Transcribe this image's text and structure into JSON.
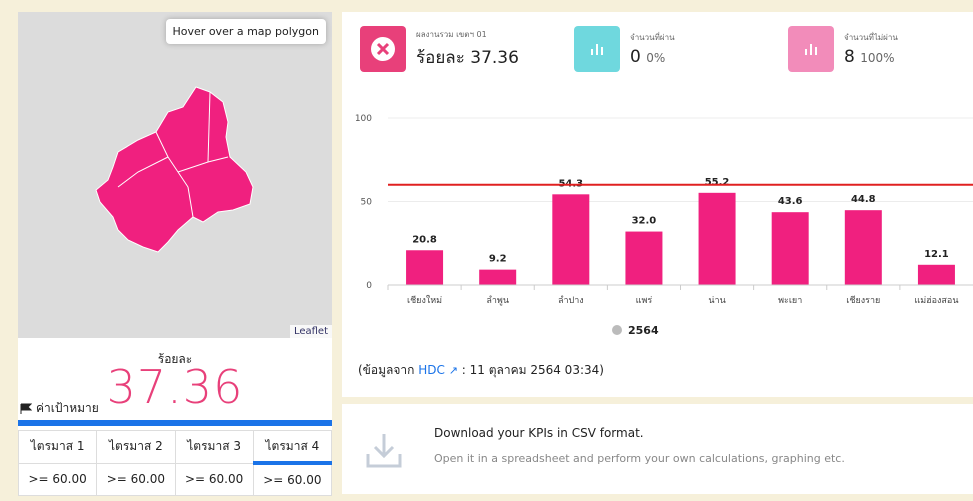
{
  "map": {
    "hover_hint": "Hover over a map polygon",
    "attribution": "Leaflet"
  },
  "summary": {
    "percent_label": "ร้อยละ",
    "percent_value": "37.36",
    "target_label": "ค่าเป้าหมาย"
  },
  "quarters": {
    "headers": [
      "ไตรมาส 1",
      "ไตรมาส 2",
      "ไตรมาส 3",
      "ไตรมาส 4"
    ],
    "values": [
      ">= 60.00",
      ">= 60.00",
      ">= 60.00",
      ">= 60.00"
    ]
  },
  "stats": [
    {
      "label": "ผลงานรวม เขตฯ 01",
      "value": "ร้อยละ 37.36",
      "sub": "",
      "color": "#e8407a",
      "icon": "close-icon"
    },
    {
      "label": "จำนวนที่ผ่าน",
      "value": "0",
      "sub": "0%",
      "color": "#6fd8de",
      "icon": "bar-chart-icon"
    },
    {
      "label": "จำนวนที่ไม่ผ่าน",
      "value": "8",
      "sub": "100%",
      "color": "#f28cba",
      "icon": "bar-chart-icon"
    }
  ],
  "chart_data": {
    "type": "bar",
    "categories": [
      "เชียงใหม่",
      "ลำพูน",
      "ลำปาง",
      "แพร่",
      "น่าน",
      "พะเยา",
      "เชียงราย",
      "แม่ฮ่องสอน"
    ],
    "series": [
      {
        "name": "2564",
        "values": [
          20.8,
          9.2,
          54.3,
          32.0,
          55.2,
          43.6,
          44.8,
          12.1
        ]
      }
    ],
    "data_labels": [
      "20.8",
      "9.2",
      "54.3",
      "32.0",
      "55.2",
      "43.6",
      "44.8",
      "12.1"
    ],
    "yticks": [
      "0",
      "50",
      "100"
    ],
    "ylim": [
      0,
      100
    ],
    "target_line": 60,
    "bar_color": "#f0207f",
    "target_color": "#e02020",
    "legend": "2564"
  },
  "source": {
    "prefix": "(ข้อมูลจาก",
    "link": "HDC",
    "suffix": ": 11 ตุลาคม 2564 03:34)"
  },
  "download": {
    "title": "Download your KPIs in CSV format.",
    "subtitle": "Open it in a spreadsheet and perform your own calculations, graphing etc."
  }
}
